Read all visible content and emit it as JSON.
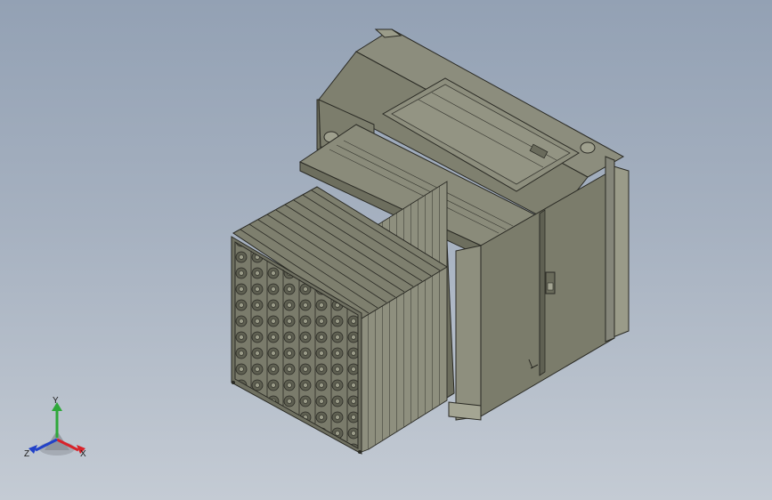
{
  "view": {
    "background_top": "#93a1b4",
    "background_bottom": "#c4cbd4",
    "model_color": "#868777",
    "edge_color": "#2a2a24"
  },
  "triad": {
    "x_label": "X",
    "y_label": "Y",
    "z_label": "Z",
    "x_color": "#d8232a",
    "y_color": "#2fa83a",
    "z_color": "#2242c8"
  }
}
